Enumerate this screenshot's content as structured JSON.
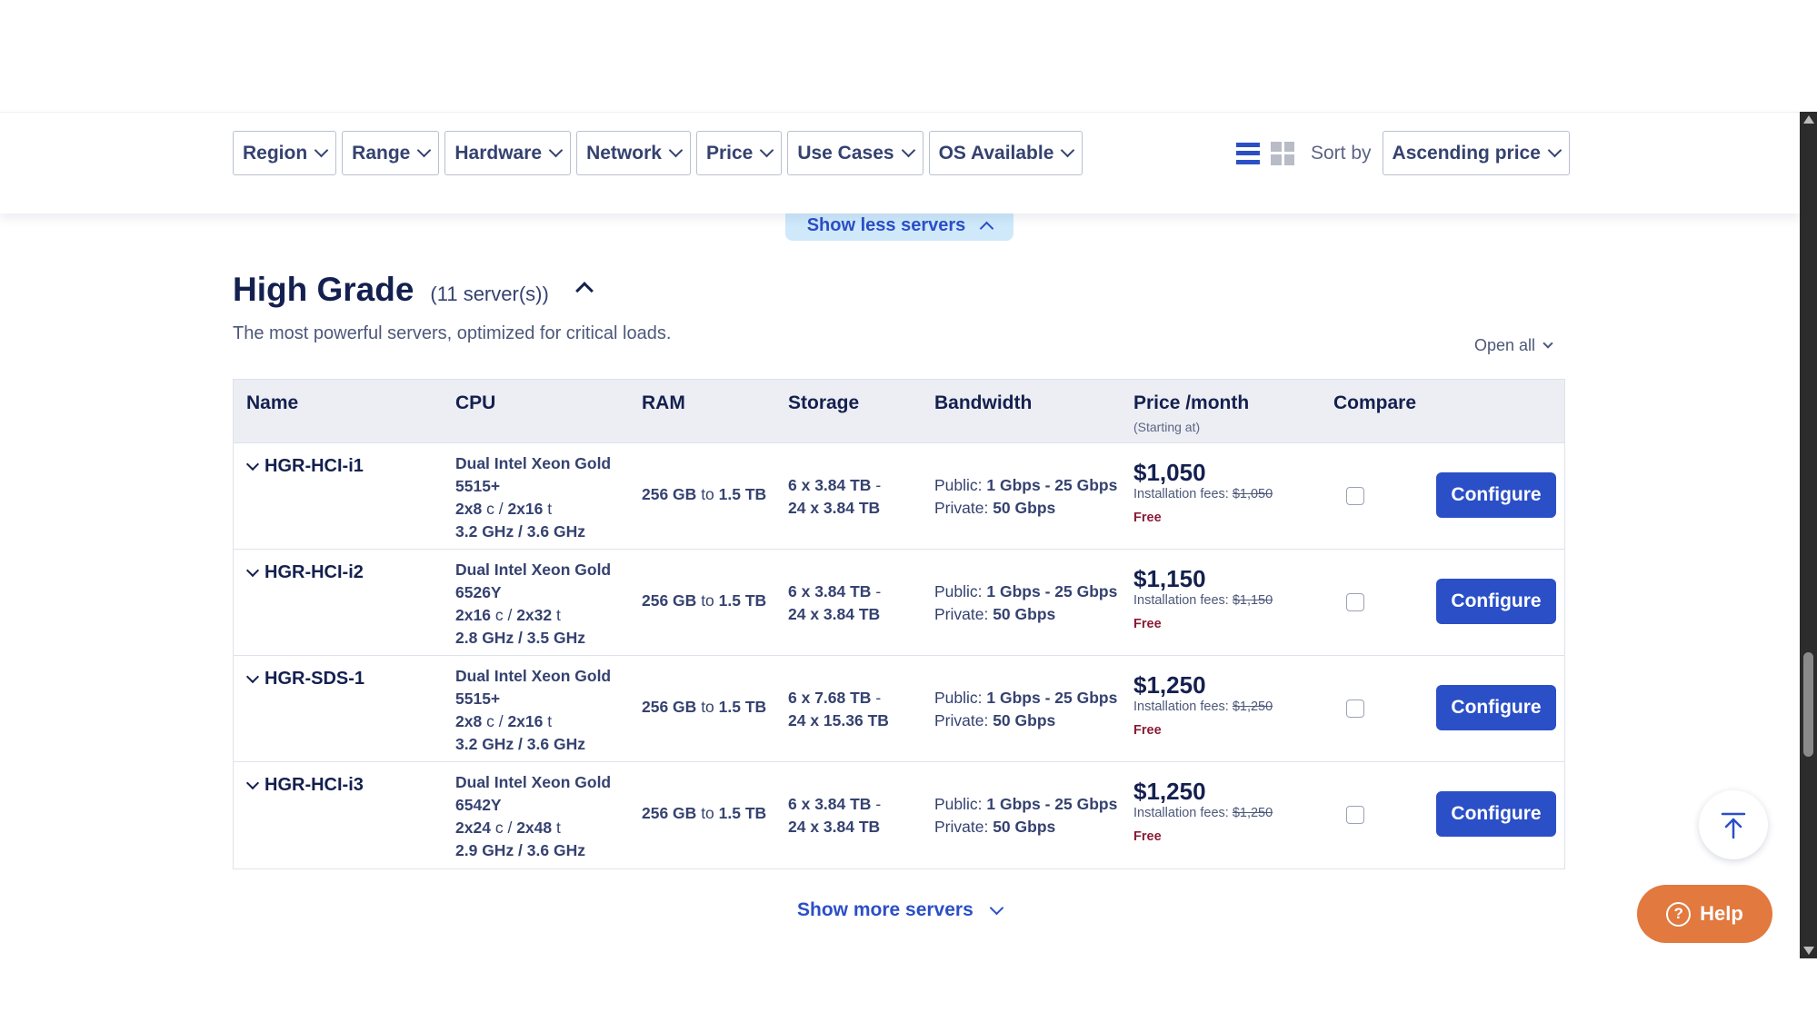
{
  "filters": [
    {
      "label": "Region"
    },
    {
      "label": "Range"
    },
    {
      "label": "Hardware"
    },
    {
      "label": "Network"
    },
    {
      "label": "Price"
    },
    {
      "label": "Use Cases"
    },
    {
      "label": "OS Available"
    }
  ],
  "sort": {
    "label": "Sort by",
    "value": "Ascending price"
  },
  "show_less": "Show less servers",
  "section": {
    "title": "High Grade",
    "count": "(11 server(s))",
    "description": "The most powerful servers, optimized for critical loads.",
    "open_all": "Open all"
  },
  "table": {
    "headers": {
      "name": "Name",
      "cpu": "CPU",
      "ram": "RAM",
      "storage": "Storage",
      "bandwidth": "Bandwidth",
      "price": "Price /month",
      "price_sub": "(Starting at)",
      "compare": "Compare"
    },
    "rows": [
      {
        "name": "HGR-HCI-i1",
        "cpu_model": "Dual Intel Xeon Gold",
        "cpu_sku": "5515+",
        "cores": "2x8",
        "c_unit": "c",
        "slash": "/",
        "threads": "2x16",
        "t_unit": "t",
        "freq": "3.2 GHz / 3.6 GHz",
        "ram_from": "256 GB",
        "ram_to_word": "to",
        "ram_to": "1.5 TB",
        "storage_from": "6 x 3.84 TB",
        "storage_sep": "-",
        "storage_to": "24 x 3.84 TB",
        "bw_public_label": "Public:",
        "bw_public": "1 Gbps - 25 Gbps",
        "bw_private_label": "Private:",
        "bw_private": "50 Gbps",
        "price": "$1,050",
        "fees_label": "Installation fees:",
        "fees": "$1,050",
        "free": "Free",
        "configure": "Configure"
      },
      {
        "name": "HGR-HCI-i2",
        "cpu_model": "Dual Intel Xeon Gold",
        "cpu_sku": "6526Y",
        "cores": "2x16",
        "c_unit": "c",
        "slash": "/",
        "threads": "2x32",
        "t_unit": "t",
        "freq": "2.8 GHz / 3.5 GHz",
        "ram_from": "256 GB",
        "ram_to_word": "to",
        "ram_to": "1.5 TB",
        "storage_from": "6 x 3.84 TB",
        "storage_sep": "-",
        "storage_to": "24 x 3.84 TB",
        "bw_public_label": "Public:",
        "bw_public": "1 Gbps - 25 Gbps",
        "bw_private_label": "Private:",
        "bw_private": "50 Gbps",
        "price": "$1,150",
        "fees_label": "Installation fees:",
        "fees": "$1,150",
        "free": "Free",
        "configure": "Configure"
      },
      {
        "name": "HGR-SDS-1",
        "cpu_model": "Dual Intel Xeon Gold",
        "cpu_sku": "5515+",
        "cores": "2x8",
        "c_unit": "c",
        "slash": "/",
        "threads": "2x16",
        "t_unit": "t",
        "freq": "3.2 GHz / 3.6 GHz",
        "ram_from": "256 GB",
        "ram_to_word": "to",
        "ram_to": "1.5 TB",
        "storage_from": "6 x 7.68 TB",
        "storage_sep": "-",
        "storage_to": "24 x 15.36 TB",
        "bw_public_label": "Public:",
        "bw_public": "1 Gbps - 25 Gbps",
        "bw_private_label": "Private:",
        "bw_private": "50 Gbps",
        "price": "$1,250",
        "fees_label": "Installation fees:",
        "fees": "$1,250",
        "free": "Free",
        "configure": "Configure"
      },
      {
        "name": "HGR-HCI-i3",
        "cpu_model": "Dual Intel Xeon Gold",
        "cpu_sku": "6542Y",
        "cores": "2x24",
        "c_unit": "c",
        "slash": "/",
        "threads": "2x48",
        "t_unit": "t",
        "freq": "2.9 GHz / 3.6 GHz",
        "ram_from": "256 GB",
        "ram_to_word": "to",
        "ram_to": "1.5 TB",
        "storage_from": "6 x 3.84 TB",
        "storage_sep": "-",
        "storage_to": "24 x 3.84 TB",
        "bw_public_label": "Public:",
        "bw_public": "1 Gbps - 25 Gbps",
        "bw_private_label": "Private:",
        "bw_private": "50 Gbps",
        "price": "$1,250",
        "fees_label": "Installation fees:",
        "fees": "$1,250",
        "free": "Free",
        "configure": "Configure"
      }
    ]
  },
  "show_more": "Show more servers",
  "help": {
    "label": "Help",
    "icon_glyph": "?"
  },
  "icons": {
    "list_view": "list-view-icon",
    "grid_view": "grid-view-icon",
    "back_to_top": "arrow-up-to-line-icon",
    "help": "question-circle-icon"
  },
  "colors": {
    "accent": "#2b4fc7",
    "help": "#e2793f",
    "free": "#8a1c35",
    "heading": "#14204f"
  }
}
